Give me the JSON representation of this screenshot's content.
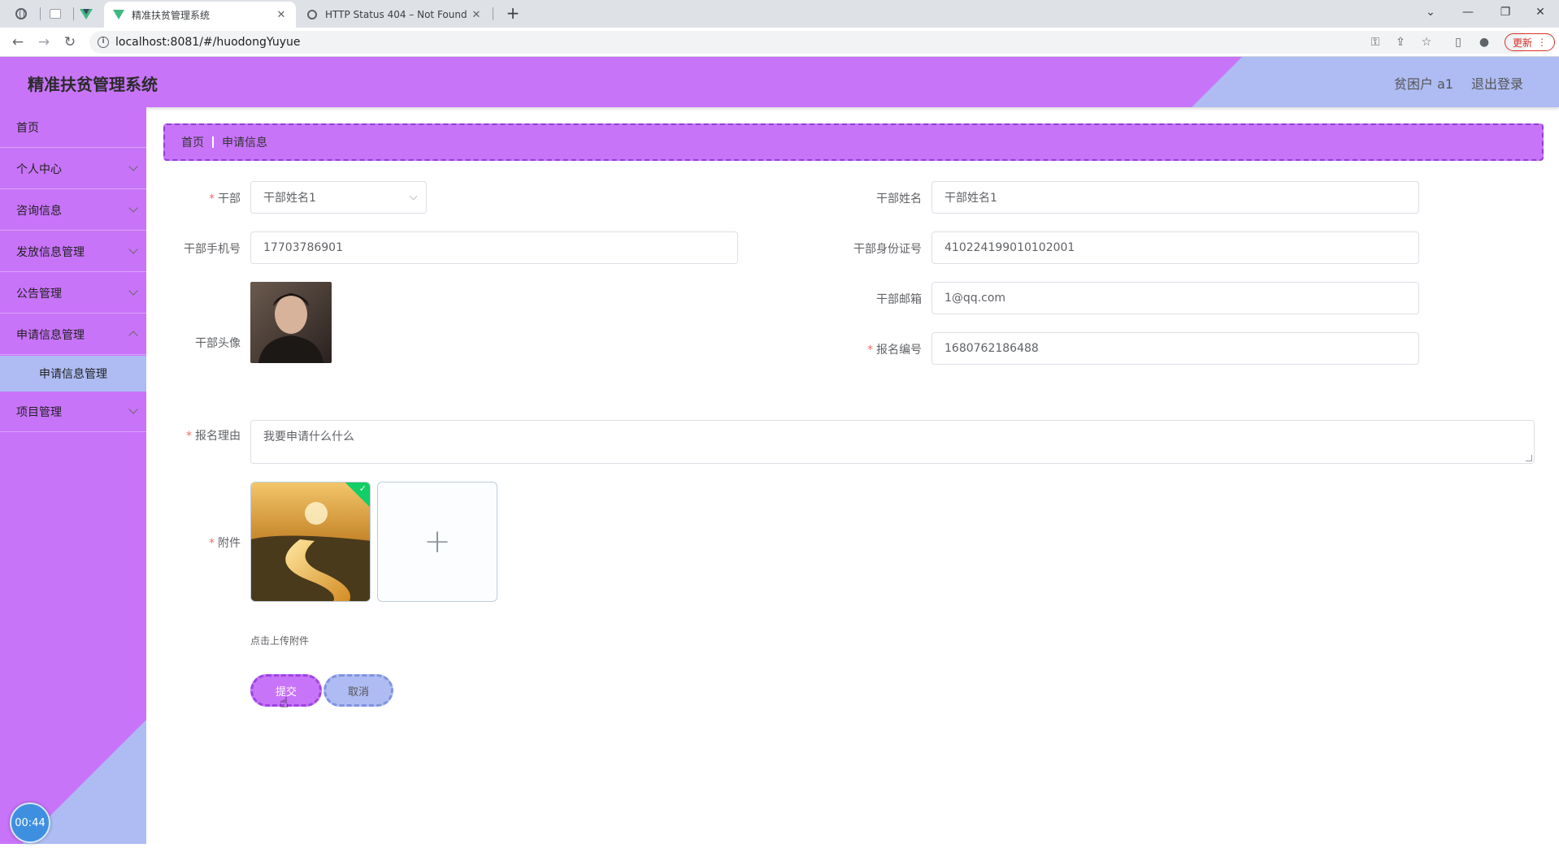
{
  "browser": {
    "tabs": [
      {
        "title": "精准扶贫管理系统",
        "active": true
      },
      {
        "title": "HTTP Status 404 – Not Found",
        "active": false
      }
    ],
    "url": "localhost:8081/#/huodongYuyue",
    "update_label": "更新"
  },
  "header": {
    "title": "精准扶贫管理系统",
    "user": "贫困户 a1",
    "logout": "退出登录"
  },
  "sidebar": {
    "items": [
      {
        "label": "首页"
      },
      {
        "label": "个人中心"
      },
      {
        "label": "咨询信息"
      },
      {
        "label": "发放信息管理"
      },
      {
        "label": "公告管理"
      },
      {
        "label": "申请信息管理"
      },
      {
        "label": "申请信息管理"
      },
      {
        "label": "项目管理"
      }
    ],
    "timer": "00:44"
  },
  "breadcrumb": {
    "home": "首页",
    "current": "申请信息"
  },
  "form": {
    "cadre": {
      "label": "干部",
      "value": "干部姓名1"
    },
    "cadre_name": {
      "label": "干部姓名",
      "value": "干部姓名1"
    },
    "cadre_phone": {
      "label": "干部手机号",
      "value": "17703786901"
    },
    "cadre_id": {
      "label": "干部身份证号",
      "value": "410224199010102001"
    },
    "cadre_avatar": {
      "label": "干部头像"
    },
    "cadre_email": {
      "label": "干部邮箱",
      "value": "1@qq.com"
    },
    "signup_no": {
      "label": "报名编号",
      "value": "1680762186488"
    },
    "reason": {
      "label": "报名理由",
      "value": "我要申请什么什么"
    },
    "attachment": {
      "label": "附件",
      "tip": "点击上传附件"
    },
    "submit": "提交",
    "cancel": "取消"
  },
  "colors": {
    "primary": "#c874f9",
    "secondary": "#aebcf3",
    "success": "#13ce66",
    "required": "#f56c6c"
  }
}
